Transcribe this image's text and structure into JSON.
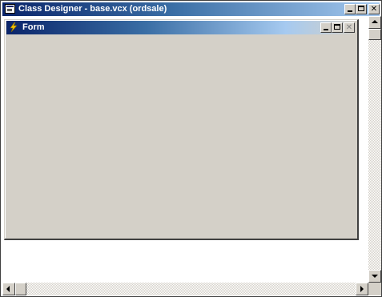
{
  "outer_window": {
    "title": "Class Designer - base.vcx (ordsale)",
    "icon": "class-designer-icon",
    "controls": [
      "minimize-icon",
      "maximize-icon",
      "close-icon"
    ]
  },
  "form_window": {
    "title": "Form",
    "icon": "form-lightning-icon",
    "controls": [
      "minimize-icon",
      "maximize-icon",
      "close-icon"
    ],
    "close_disabled": true
  },
  "colors": {
    "titlebar_active": "#0a246a",
    "titlebar_gradient_end": "#a6caf0",
    "form_background": "#d4d0c8",
    "designer_background": "#ffffff"
  },
  "scrollbars": {
    "vertical": "present",
    "horizontal": "present"
  }
}
